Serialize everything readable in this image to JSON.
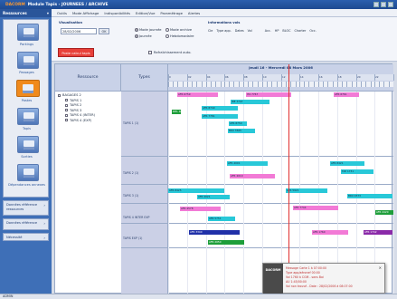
{
  "window": {
    "app_name": "DACORM",
    "title": "Module Tapis - JOURNEES / ARCHIVE"
  },
  "sidebar": {
    "header": "Ressources",
    "tiles": [
      {
        "label": "Parkings",
        "icon": "parking-icon"
      },
      {
        "label": "Passages",
        "icon": "passage-icon"
      },
      {
        "label": "Postes",
        "icon": "post-icon",
        "active": true
      },
      {
        "label": "Tapis",
        "icon": "carpet-icon"
      },
      {
        "label": "Sorties",
        "icon": "exit-icon"
      },
      {
        "label": "Dépendances annexes",
        "icon": "annex-icon"
      }
    ],
    "sections": [
      {
        "label": "Données référence ressources"
      },
      {
        "label": "Données référence"
      },
      {
        "label": "Nécessité"
      }
    ]
  },
  "menu": [
    "Outils",
    "Mode Affichage",
    "Indisponibilités",
    "Edition/Vue",
    "Paramétrage",
    "Alertes"
  ],
  "toolbar": {
    "visualisation_title": "Visualisation",
    "date_value": "28/02/2006",
    "ok_label": "OK",
    "radios": [
      {
        "label": "Mode journée",
        "checked": true
      },
      {
        "label": "Journée",
        "checked": true
      },
      {
        "label": "Mode archive",
        "checked": false
      },
      {
        "label": "Hebdomadaire",
        "checked": false
      }
    ],
    "info_title": "Informations vols",
    "info_cols": [
      "Cie",
      "Type app.",
      "Dates",
      "Vol",
      "Acc.",
      "HP",
      "BLOC",
      "Charter",
      "Occ."
    ],
    "action_button": "Poste calcul tapis",
    "auto_refresh": "Rafraîchissement auto."
  },
  "gantt": {
    "tree_header": "Ressource",
    "type_header": "Types",
    "day_label": "Jeudi 16 - Mercredi 08 Mars 2006",
    "hours": [
      "0",
      "02",
      "04",
      "06",
      "08",
      "10",
      "12",
      "14",
      "16",
      "18",
      "20",
      "22",
      "0"
    ],
    "tree": [
      "BAGAGES 2",
      "TAPIS 1",
      "TAPIS 2",
      "TAPIS 3",
      "TAPIS 4 (INTER)",
      "TAPIS 4 (EXP)"
    ],
    "rows": [
      {
        "label": "TAPIS 1 (1)"
      },
      {
        "label": "TAPIS 2 (1)"
      },
      {
        "label": "TAPIS 3 (1)"
      },
      {
        "label": "TAPIS 4 INTER EXP"
      },
      {
        "label": "TAPIS EXP (1)"
      }
    ],
    "bars": [
      {
        "label": "AFR 6759",
        "color": "#f27ad6"
      },
      {
        "label": "ITA 7767",
        "color": "#f27ad6"
      },
      {
        "label": "AFR 6761",
        "color": "#f27ad6"
      },
      {
        "label": "IBE 3707",
        "color": "#28c8d8"
      },
      {
        "label": "AFR 8749",
        "color": "#28c8d8"
      },
      {
        "label": "AFR 7781",
        "color": "#28c8d8"
      },
      {
        "label": "AFR 8750",
        "color": "#28c8d8"
      },
      {
        "label": "BRU 3565",
        "color": "#28c8d8"
      },
      {
        "label": "DHL 4021",
        "color": "#1e9e3a"
      },
      {
        "label": "AFR 4001",
        "color": "#28c8d8"
      },
      {
        "label": "AFR 8421",
        "color": "#28c8d8"
      },
      {
        "label": "TAP 1731",
        "color": "#28c8d8"
      },
      {
        "label": "AFR 4010",
        "color": "#f27ad6"
      },
      {
        "label": "AFR 8425",
        "color": "#28c8d8"
      },
      {
        "label": "AFR 5921",
        "color": "#28c8d8"
      },
      {
        "label": "BRU 4573",
        "color": "#28c8d8"
      },
      {
        "label": "AFR 4021",
        "color": "#28c8d8"
      },
      {
        "label": "AFR 4578",
        "color": "#f27ad6"
      },
      {
        "label": "AFR 7744",
        "color": "#f27ad6"
      },
      {
        "label": "AFR 4420",
        "color": "#1e9e3a"
      },
      {
        "label": "AFR 5751",
        "color": "#28c8d8"
      },
      {
        "label": "AFR 3340",
        "color": "#2030a8"
      },
      {
        "label": "AFR 1760",
        "color": "#f27ad6"
      },
      {
        "label": "AFR 1742",
        "color": "#8a2aa8"
      },
      {
        "label": "AFR 2050",
        "color": "#1e9e3a"
      }
    ]
  },
  "popup": {
    "header": "DACORM",
    "lines": [
      "Message Carte 1 à 07:00:00",
      "Type app/aéronef 00:00",
      "Vol 1760 à CGM - sans Bai",
      "AU 1:45/00:00",
      "Vol non trouvé - Date : 28/02/2006 à 08:07:00"
    ]
  },
  "status": {
    "text": "ADMIN"
  }
}
